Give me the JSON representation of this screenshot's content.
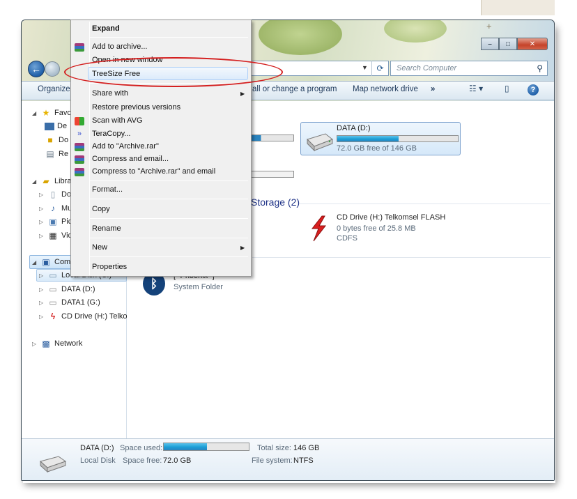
{
  "window": {
    "search_placeholder": "Search Computer",
    "caption": {
      "minimize": "–",
      "maximize": "□",
      "close": "✕"
    },
    "taskbar_plus": "+"
  },
  "command_bar": {
    "organize": "Organize",
    "uninstall": "all or change a program",
    "map_drive": "Map network drive",
    "more": "»",
    "help": "?"
  },
  "nav_pane": {
    "favorites": "Favo",
    "fav_items": [
      "De",
      "Do",
      "Re"
    ],
    "libraries": "Libra",
    "lib_items": [
      "Do",
      "Mu",
      "Pic",
      "Vid"
    ],
    "computer": "Com",
    "computer_items": [
      "Local Disk (C:)",
      "DATA (D:)",
      "DATA1 (G:)",
      "CD Drive (H:) Telkor"
    ],
    "network": "Network"
  },
  "content": {
    "drive_d": {
      "name": "DATA (D:)",
      "free_text": "72.0 GB free of 146 GB",
      "used_fraction": 0.51
    },
    "group_removable": "Storage (2)",
    "cd_drive": {
      "name": "CD Drive (H:) Telkomsel FLASH",
      "free_text": "0 bytes free of 25.8 MB",
      "fs": "CDFS"
    },
    "bluetooth": {
      "name": "[=Phoenix=]",
      "type": "System Folder"
    }
  },
  "details": {
    "name": "DATA (D:)",
    "type": "Local Disk",
    "space_used_label": "Space used:",
    "space_free_label": "Space free:",
    "space_free": "72.0 GB",
    "total_label": "Total size:",
    "total": "146 GB",
    "fs_label": "File system:",
    "fs": "NTFS",
    "used_fraction": 0.51
  },
  "context_menu": {
    "expand": "Expand",
    "add_archive": "Add to archive...",
    "open_new_window": "Open in new window",
    "treesize": "TreeSize Free",
    "share_with": "Share with",
    "restore": "Restore previous versions",
    "scan_avg": "Scan with AVG",
    "teracopy": "TeraCopy...",
    "add_archive_rar": "Add to \"Archive.rar\"",
    "compress_email": "Compress and email...",
    "compress_rar_email": "Compress to \"Archive.rar\" and email",
    "format": "Format...",
    "copy": "Copy",
    "rename": "Rename",
    "new": "New",
    "properties": "Properties"
  },
  "colors": {
    "annotation_red": "#d42020",
    "bar_fill": "#1b9ed6",
    "group_heading": "#1e3287"
  }
}
